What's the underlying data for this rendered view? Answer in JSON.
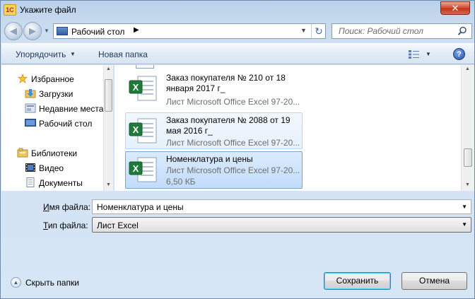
{
  "window": {
    "title": "Укажите файл",
    "app_icon_text": "1С",
    "close_symbol": "✕"
  },
  "navigation": {
    "back_symbol": "◀",
    "forward_symbol": "▶",
    "history_symbol": "▼",
    "address_location": "Рабочий стол",
    "address_separator": "▶",
    "address_dropdown_symbol": "▼",
    "refresh_symbol": "↻",
    "search_placeholder": "Поиск: Рабочий стол"
  },
  "toolbar": {
    "organize_label": "Упорядочить",
    "organize_arrow": "▼",
    "new_folder_label": "Новая папка",
    "view_arrow": "▼",
    "help_label": "?"
  },
  "sidebar": {
    "items": [
      {
        "label": "Избранное",
        "icon": "star-icon"
      },
      {
        "label": "Загрузки",
        "icon": "downloads-icon"
      },
      {
        "label": "Недавние места",
        "icon": "recent-places-icon"
      },
      {
        "label": "Рабочий стол",
        "icon": "desktop-icon"
      },
      {
        "label": "Библиотеки",
        "icon": "libraries-icon"
      },
      {
        "label": "Видео",
        "icon": "video-icon"
      },
      {
        "label": "Документы",
        "icon": "documents-icon"
      }
    ]
  },
  "files": [
    {
      "name": "Заказ покупателя № 210 от 18 января 2017 г_",
      "type": "Лист Microsoft Office Excel 97-20...",
      "size": "",
      "state": "normal"
    },
    {
      "name": "Заказ покупателя № 2088 от 19 мая 2016 г_",
      "type": "Лист Microsoft Office Excel 97-20...",
      "size": "",
      "state": "hover"
    },
    {
      "name": "Номенклатура и цены",
      "type": "Лист Microsoft Office Excel 97-20...",
      "size": "6,50 КБ",
      "state": "selected"
    }
  ],
  "form": {
    "filename_label_accel": "И",
    "filename_label_rest": "мя файла:",
    "filename_value": "Номенклатура и цены",
    "filetype_label_accel": "Т",
    "filetype_label_rest": "ип файла:",
    "filetype_value": "Лист Excel",
    "dropdown_symbol": "▼"
  },
  "footer": {
    "hide_folders_label": "Скрыть папки",
    "hide_folders_symbol": "▲",
    "save_label": "Сохранить",
    "cancel_label": "Отмена"
  },
  "colors": {
    "selection": "#c1dcfc",
    "hover": "#e6f1fc",
    "excel_green": "#1f7a3a",
    "title_bar": "#b9d1ea"
  }
}
